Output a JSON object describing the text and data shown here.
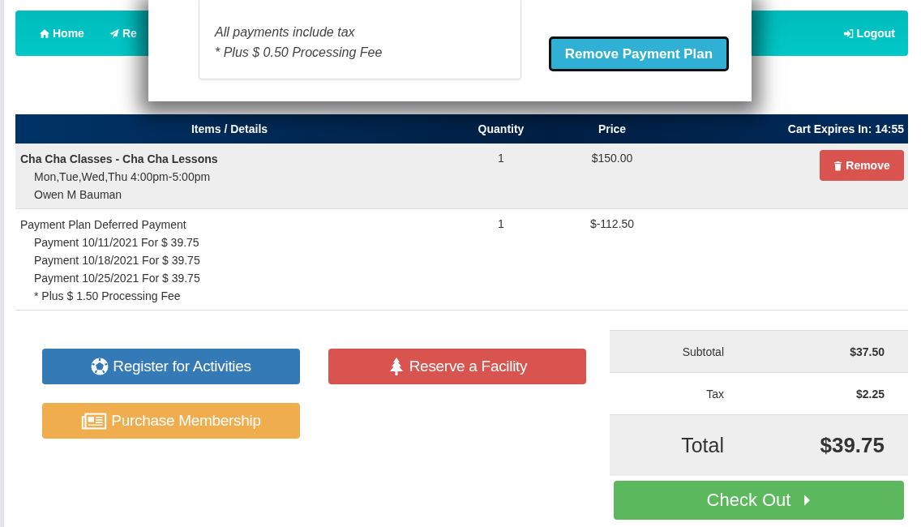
{
  "navbar": {
    "items": [
      {
        "label": "Home",
        "kind": "home"
      },
      {
        "label": "Re",
        "kind": "send"
      }
    ],
    "logout": "Logout"
  },
  "modal": {
    "notes": [
      "All payments include tax",
      "* Plus $ 0.50 Processing Fee"
    ],
    "button": "Remove Payment Plan"
  },
  "cart": {
    "columns": [
      "Items / Details",
      "Quantity",
      "Price"
    ],
    "expires": "Cart Expires In: 14:55",
    "rows": [
      {
        "title": "Cha Cha Classes - Cha Cha Lessons",
        "bold": true,
        "details": [
          "Mon,Tue,Wed,Thu 4:00pm-5:00pm",
          "Owen M Bauman"
        ],
        "quantity": "1",
        "price": "$150.00",
        "action": "Remove"
      },
      {
        "title": "Payment Plan Deferred Payment",
        "bold": false,
        "details": [
          "Payment 10/11/2021 For $ 39.75",
          "Payment 10/18/2021 For $ 39.75",
          "Payment 10/25/2021 For $ 39.75",
          "* Plus $ 1.50 Processing Fee"
        ],
        "quantity": "1",
        "price": "$-112.50"
      }
    ]
  },
  "actions": [
    {
      "label": "Register for Activities",
      "kind": "register"
    },
    {
      "label": "Reserve a Facility",
      "kind": "facility"
    },
    {
      "label": "Purchase Membership",
      "kind": "membership"
    }
  ],
  "summary": {
    "rows": [
      {
        "label": "Subtotal",
        "value": "$37.50"
      },
      {
        "label": "Tax",
        "value": "$2.25"
      }
    ],
    "total_label": "Total",
    "total": "$39.75",
    "checkout": "Check Out"
  }
}
